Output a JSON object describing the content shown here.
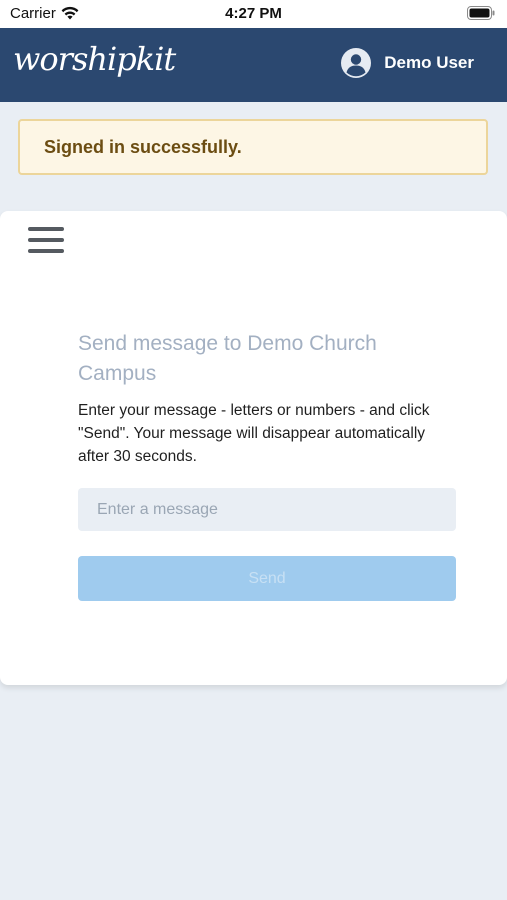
{
  "status_bar": {
    "carrier": "Carrier",
    "time": "4:27 PM",
    "wifi_icon": "wifi-icon",
    "battery_icon": "battery-icon"
  },
  "header": {
    "logo_text": "worshipkit",
    "user_name": "Demo User",
    "avatar_icon": "user-avatar-icon",
    "background": "#2b4870"
  },
  "flash": {
    "message": "Signed in successfully.",
    "background": "#fdf6e5",
    "border": "#ecd59a",
    "text_color": "#6c4d12"
  },
  "card": {
    "menu_icon": "hamburger-menu-icon",
    "title": "Send message to Demo Church Campus",
    "help_text": "Enter your message - letters or numbers - and click \"Send\". Your message will disappear automatically after 30 seconds.",
    "input": {
      "value": "",
      "placeholder": "Enter a message"
    },
    "send_label": "Send",
    "send_button_color": "#9fcbee"
  }
}
